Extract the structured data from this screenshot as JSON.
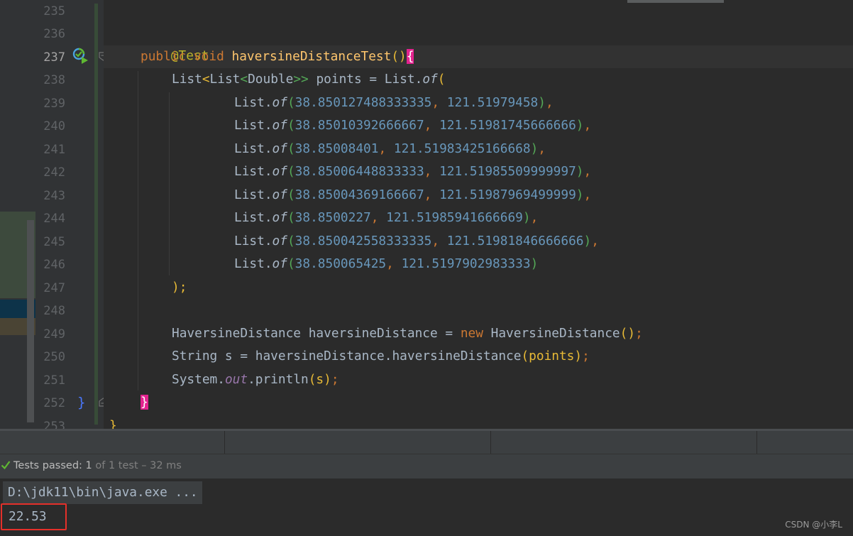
{
  "editor": {
    "line_numbers": [
      "235",
      "236",
      "237",
      "238",
      "239",
      "240",
      "241",
      "242",
      "243",
      "244",
      "245",
      "246",
      "247",
      "248",
      "249",
      "250",
      "251",
      "252",
      "253"
    ],
    "active_line": "237",
    "code": {
      "annotation": "@Test",
      "method_signature": {
        "public": "public",
        "void": "void",
        "name": "haversineDistanceTest",
        "open": "()",
        "brace": "{"
      },
      "points_decl": "List<List<Double>> points = List.of(",
      "points_decl_parts": {
        "type": "List",
        "lt1": "<",
        "type2": "List",
        "lt2": "<",
        "type3": "Double",
        "gt": ">>",
        "rest": " points = List.",
        "of": "of",
        "paren": "("
      },
      "points": [
        {
          "lat": "38.850127488333335",
          "lon": "121.51979458",
          "tail": ","
        },
        {
          "lat": "38.85010392666667",
          "lon": "121.51981745666666",
          "tail": ","
        },
        {
          "lat": "38.85008401",
          "lon": "121.51983425166668",
          "tail": ","
        },
        {
          "lat": "38.85006448833333",
          "lon": "121.51985509999997",
          "tail": ","
        },
        {
          "lat": "38.85004369166667",
          "lon": "121.51987969499999",
          "tail": ","
        },
        {
          "lat": "38.8500227",
          "lon": "121.51985941666669",
          "tail": ","
        },
        {
          "lat": "38.850042558333335",
          "lon": "121.51981846666666",
          "tail": ","
        },
        {
          "lat": "38.850065425",
          "lon": "121.5197902983333",
          "tail": ""
        }
      ],
      "list_prefix": "List.",
      "of": "of",
      "close_list": ");",
      "line249": {
        "type": "HaversineDistance",
        "var": " haversineDistance = ",
        "new": "new",
        "ctor": " HaversineDistance",
        "parens": "()",
        "semi": ";"
      },
      "line250": {
        "text": "String s = haversineDistance.haversineDistance",
        "arg": "(points)",
        "semi": ";"
      },
      "line251": {
        "sys": "System.",
        "out": "out",
        "call": ".println",
        "arg": "(s)",
        "semi": ";"
      },
      "class_close": "}",
      "method_close": "}"
    }
  },
  "test_status": {
    "label": "Tests passed:",
    "count": "1",
    "detail": "of 1 test – 32 ms"
  },
  "console": {
    "command": "D:\\jdk11\\bin\\java.exe ...",
    "output": "22.53"
  },
  "watermark": "CSDN @小李L",
  "colors": {
    "keyword": "#cc7832",
    "number": "#6897bb",
    "method": "#ffc66d",
    "highlight_box": "#e5302a",
    "brace_highlight": "#e3238f"
  }
}
